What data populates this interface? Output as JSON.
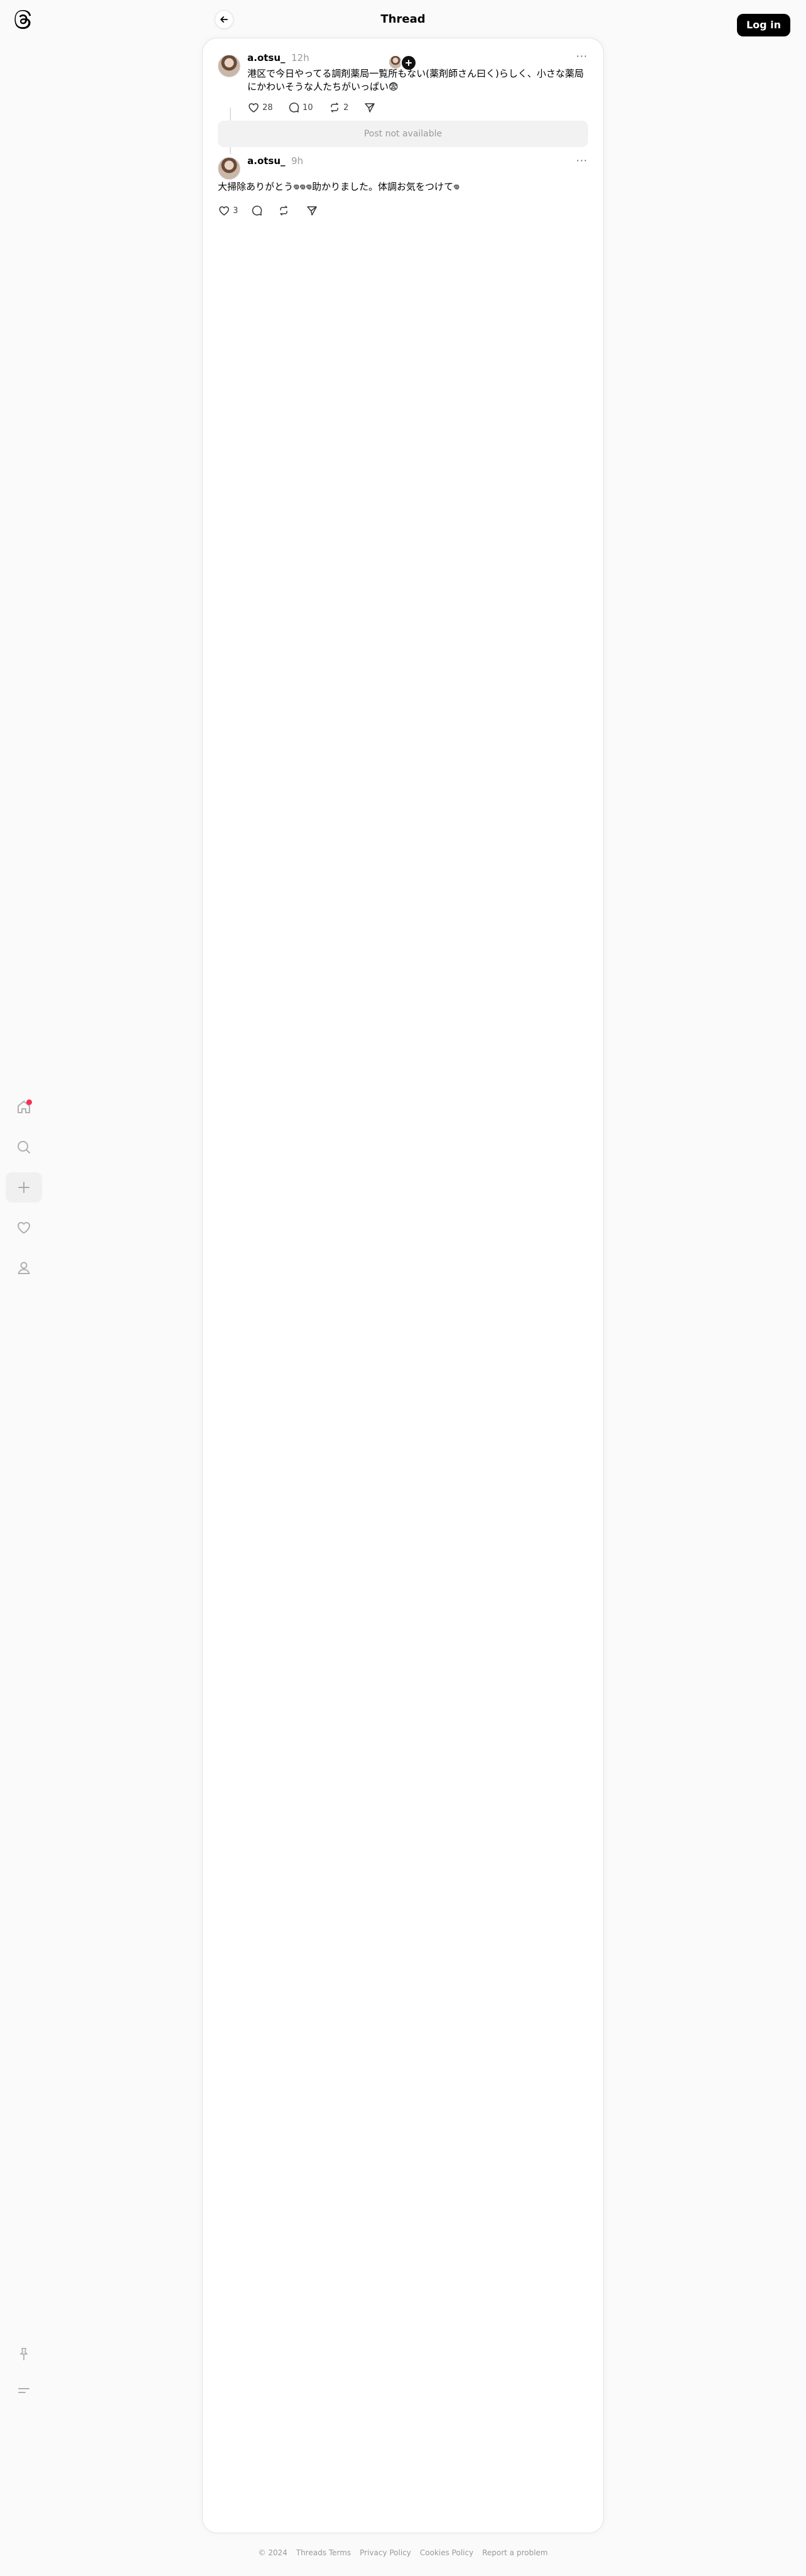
{
  "header": {
    "title": "Thread",
    "login_label": "Log in"
  },
  "icons": {
    "logo": "threads-logo-icon",
    "back": "arrow-left-icon",
    "home": "home-icon",
    "search": "search-icon",
    "create": "plus-icon",
    "activity": "heart-icon",
    "profile": "person-icon",
    "pin": "pin-icon",
    "menu": "menu-icon",
    "more": "more-horizontal-icon",
    "like": "heart-icon",
    "reply": "comment-icon",
    "repost": "repost-icon",
    "share": "send-icon"
  },
  "colors": {
    "notification_dot": "#ff2d55",
    "login_bg": "#000000",
    "card_bg": "#ffffff",
    "page_bg": "#fafafa"
  },
  "posts": [
    {
      "username": "a.otsu_",
      "time": "12h",
      "text": "港区で今日やってる調剤薬局一覧所もない(薬剤師さん曰く)らしく、小さな薬局にかわいそうな人たちがいっぱい😨",
      "likes": "28",
      "replies": "10",
      "reposts": "2"
    },
    {
      "username": "a.otsu_",
      "time": "9h",
      "text": "大掃除ありがとう𖦹𖦹𖦹助かりました。体調お気をつけて𖦹",
      "likes": "3",
      "replies": "",
      "reposts": ""
    }
  ],
  "quoted_unavailable": "Post not available",
  "more_label": "···",
  "footer": {
    "copyright": "© 2024",
    "terms": "Threads Terms",
    "privacy": "Privacy Policy",
    "cookies": "Cookies Policy",
    "report": "Report a problem"
  }
}
